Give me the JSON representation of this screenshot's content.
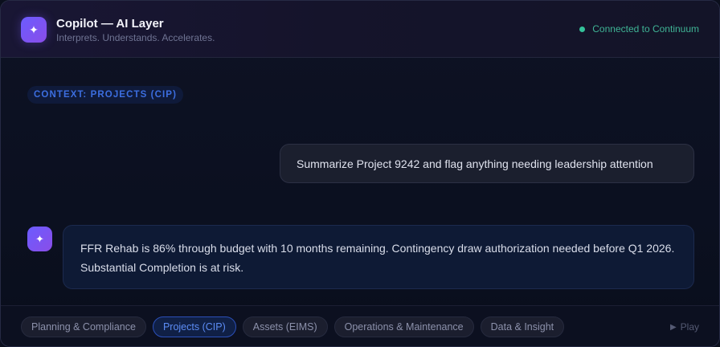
{
  "header": {
    "logo_icon": "sparkle-icon",
    "title": "Copilot — AI Layer",
    "subtitle": "Interprets. Understands. Accelerates.",
    "status": {
      "label": "Connected to Continuum",
      "color": "#34c29a"
    }
  },
  "context": {
    "label": "CONTEXT: PROJECTS (CIP)"
  },
  "conversation": {
    "user_message": "Summarize Project 9242 and flag anything needing leadership attention",
    "ai_avatar_icon": "sparkle-icon",
    "ai_message": "FFR Rehab is 86% through budget with 10 months remaining. Contingency draw authorization needed before Q1 2026. Substantial Completion is at risk."
  },
  "footer": {
    "tabs": [
      {
        "label": "Planning & Compliance",
        "active": false
      },
      {
        "label": "Projects (CIP)",
        "active": true
      },
      {
        "label": "Assets (EIMS)",
        "active": false
      },
      {
        "label": "Operations & Maintenance",
        "active": false
      },
      {
        "label": "Data & Insight",
        "active": false
      }
    ],
    "play": {
      "icon": "play-icon",
      "label": "Play"
    }
  },
  "colors": {
    "accent": "#6b5cff",
    "active_tab": "#5c8cf5",
    "status_green": "#34c29a"
  }
}
